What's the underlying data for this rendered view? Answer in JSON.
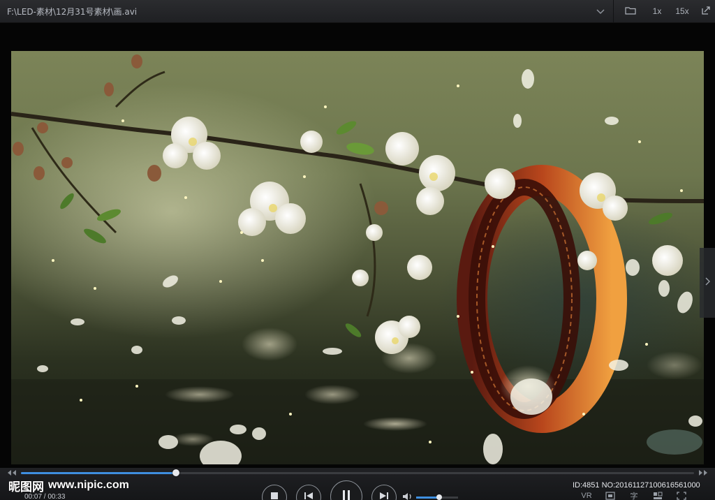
{
  "window": {
    "title": "F:\\LED-素材\\12月31号素材\\画.avi"
  },
  "toolbar": {
    "speed_1x": "1x",
    "speed_15x": "15x"
  },
  "watermark": {
    "brand": "昵图网",
    "site": "www.nipic.com"
  },
  "playback": {
    "time_display": "00:07 / 00:33",
    "progress_fraction": 0.23,
    "volume_fraction": 0.55
  },
  "media_info": {
    "id_text": "ID:4851 NO:20161127100616561000"
  },
  "right_tools": {
    "vr": "VR",
    "subtitle": "字"
  },
  "colors": {
    "accent": "#3f8fe0",
    "titlebar": "#25262a",
    "controlbar": "#1a1b1d"
  },
  "icons": [
    "folder-icon",
    "chevron-down-icon",
    "screenshot-icon",
    "pin-icon",
    "stop-icon",
    "previous-icon",
    "pause-icon",
    "next-icon",
    "volume-icon",
    "chevron-right-icon"
  ]
}
